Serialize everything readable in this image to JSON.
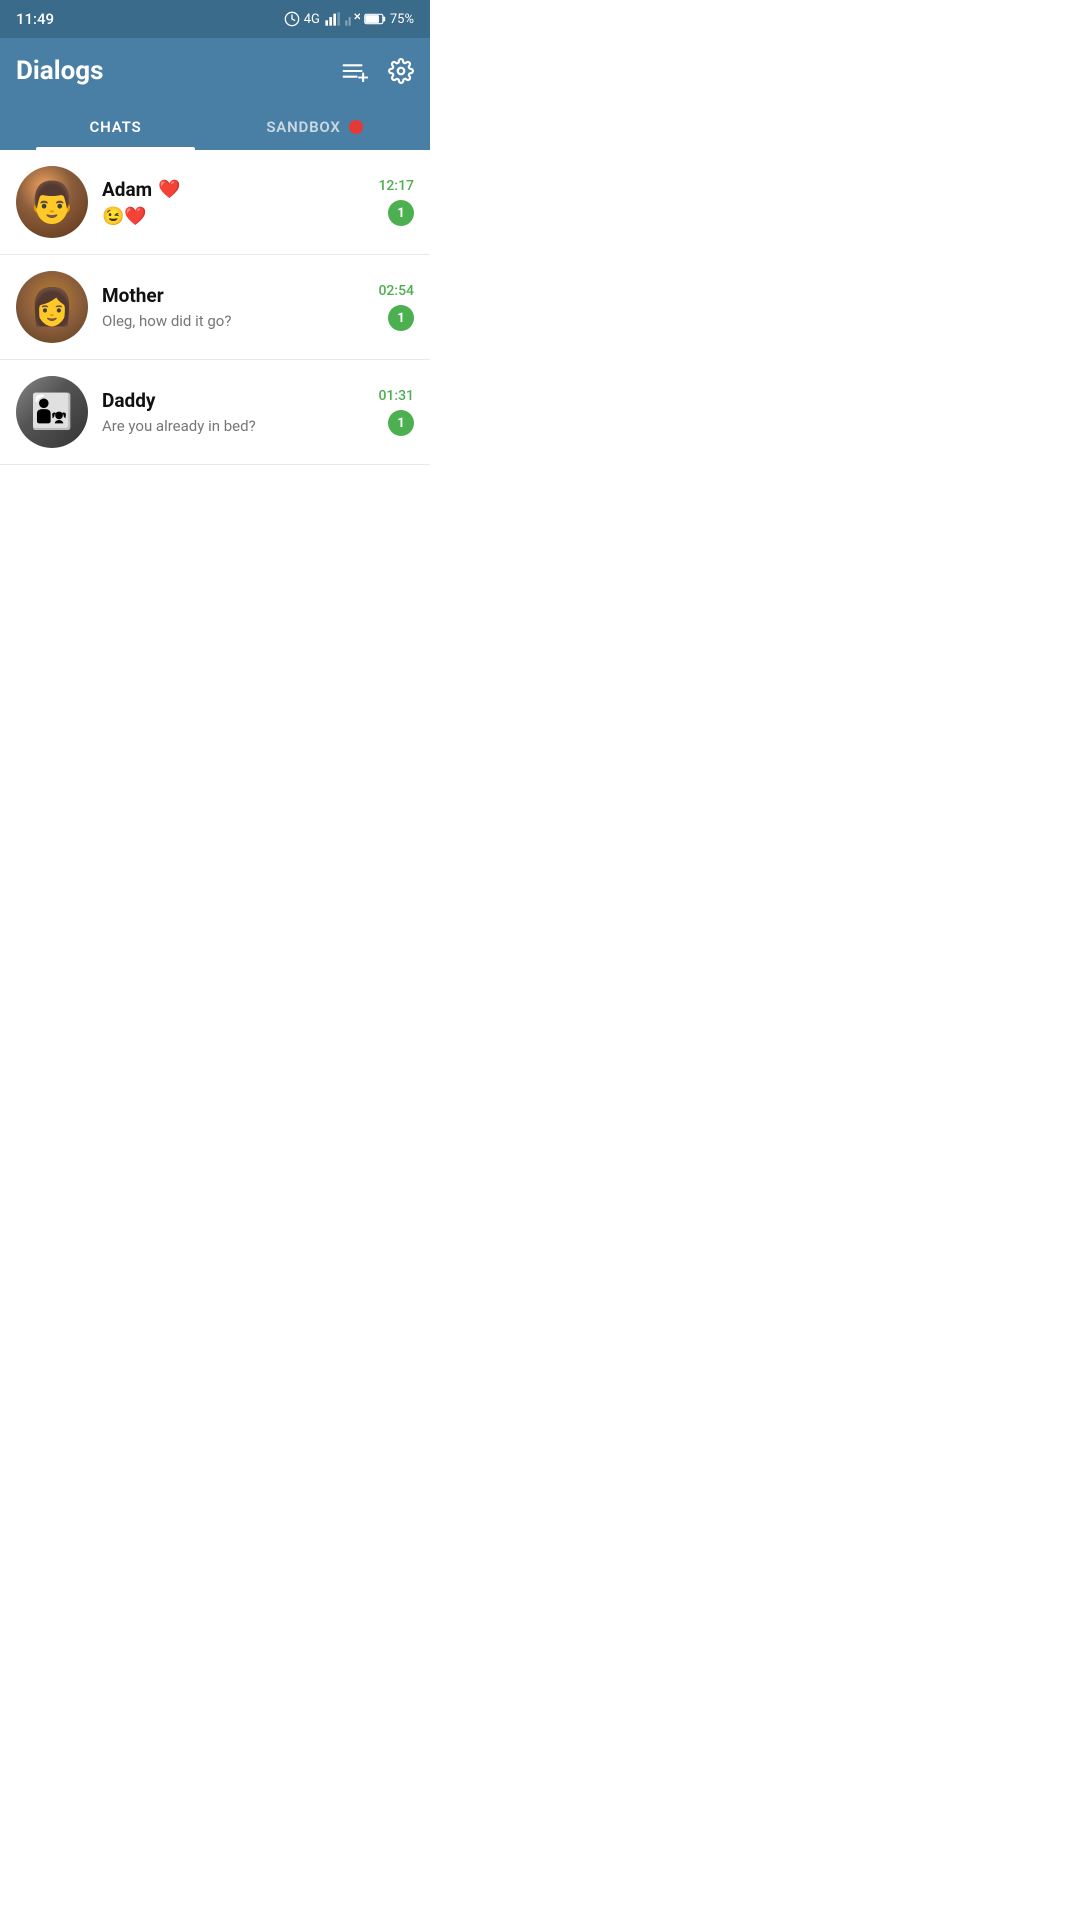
{
  "statusBar": {
    "time": "11:49",
    "signal": "4G",
    "battery": "75%"
  },
  "header": {
    "title": "Dialogs",
    "newChatIcon": "new-chat-icon",
    "settingsIcon": "settings-icon"
  },
  "tabs": [
    {
      "id": "chats",
      "label": "CHATS",
      "active": true
    },
    {
      "id": "sandbox",
      "label": "SANDBOX",
      "active": false
    }
  ],
  "sandboxDot": true,
  "chats": [
    {
      "id": "adam",
      "name": "Adam",
      "nameEmoji": "❤️",
      "preview": "😉❤️",
      "time": "12:17",
      "unread": 1,
      "avatarClass": "avatar-adam"
    },
    {
      "id": "mother",
      "name": "Mother",
      "nameEmoji": "",
      "preview": "Oleg, how did it go?",
      "time": "02:54",
      "unread": 1,
      "avatarClass": "avatar-mother"
    },
    {
      "id": "daddy",
      "name": "Daddy",
      "nameEmoji": "",
      "preview": "Are you already in bed?",
      "time": "01:31",
      "unread": 1,
      "avatarClass": "avatar-daddy"
    }
  ]
}
